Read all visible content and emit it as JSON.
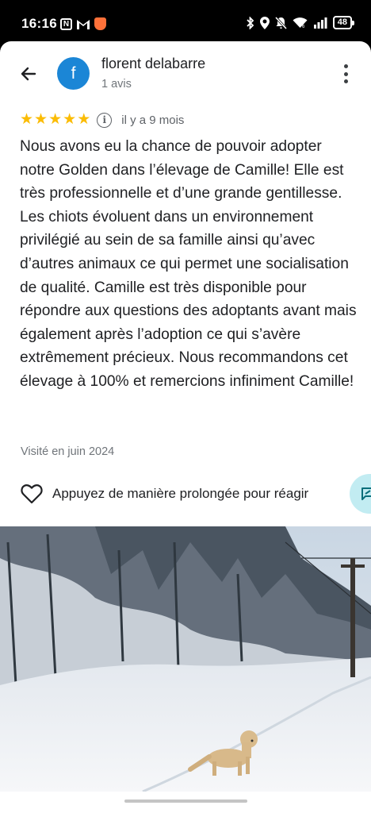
{
  "status_bar": {
    "time": "16:16",
    "battery": "48",
    "left_icons": [
      "n-icon",
      "gmail-icon",
      "shield-icon"
    ],
    "right_icons": [
      "bluetooth-icon",
      "location-icon",
      "bell-off-icon",
      "wifi-icon",
      "signal-icon",
      "battery-icon"
    ]
  },
  "header": {
    "avatar_letter": "f",
    "avatar_color": "#1b86d6",
    "reviewer_name": "florent delabarre",
    "review_count": "1 avis"
  },
  "review": {
    "rating": 5,
    "star_color": "#fbbc04",
    "date": "il y a 9 mois",
    "text": "Nous avons eu la chance de pouvoir adopter notre Golden dans l’élevage de Camille! Elle est très professionnelle et d’une grande gentillesse. Les chiots évoluent dans un environnement privilégié au sein de sa famille ainsi qu’avec d’autres animaux ce qui permet une socialisation de qualité. Camille est très disponible pour répondre aux questions des adoptants avant mais également après l’adoption ce qui s’avère extrêmement précieux. Nous recommandons cet élevage à 100% et remercions infiniment Camille!",
    "visit": "Visité en juin 2024"
  },
  "reactions": {
    "label": "Appuyez de manière prolongée pour réagir",
    "reply_chip_color": "#c2ecf2"
  }
}
